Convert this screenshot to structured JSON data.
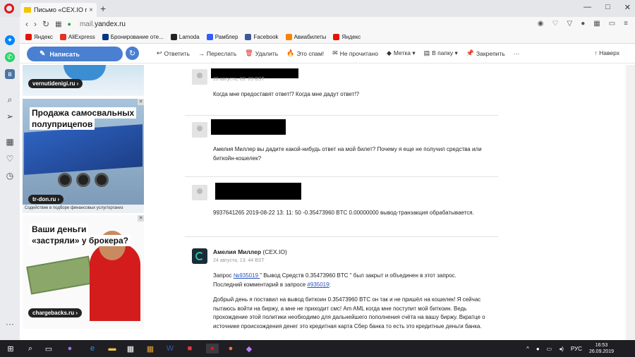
{
  "browser": {
    "tab_title": "Письмо «CEX.IO request»",
    "tab_close": "×",
    "new_tab": "+",
    "window_buttons": [
      "—",
      "□",
      "✕"
    ],
    "url_prefix": "mail.",
    "url_domain": "yandex.ru",
    "bookmarks": [
      {
        "label": "Яндекс",
        "color": "#e61400"
      },
      {
        "label": "AliExpress",
        "color": "#e43225"
      },
      {
        "label": "Бронирование оте...",
        "color": "#003580"
      },
      {
        "label": "Lamoda",
        "color": "#222222"
      },
      {
        "label": "Рамблер",
        "color": "#315efb"
      },
      {
        "label": "Facebook",
        "color": "#3b5998"
      },
      {
        "label": "Авиабилеты",
        "color": "#ff7f00"
      },
      {
        "label": "Яндекс",
        "color": "#e61400"
      }
    ],
    "sidebar_icons": [
      "messenger-icon",
      "whatsapp-icon",
      "vk-icon",
      "search-icon",
      "send-icon",
      "speed-dial-icon",
      "heart-icon",
      "history-icon",
      "more-icon"
    ]
  },
  "mail": {
    "compose_label": "Написать",
    "actions": [
      {
        "icon": "↩",
        "label": "Ответить"
      },
      {
        "icon": "→",
        "label": "Переслать"
      },
      {
        "icon": "🗑",
        "label": "Удалить"
      },
      {
        "icon": "🔥",
        "label": "Это спам!"
      },
      {
        "icon": "✉",
        "label": "Не прочитано"
      },
      {
        "icon": "◆",
        "label": "Метка ▾"
      },
      {
        "icon": "▤",
        "label": "В папку ▾"
      },
      {
        "icon": "📌",
        "label": "Закрепить"
      },
      {
        "icon": "",
        "label": "···"
      }
    ],
    "back_label": "Наверх",
    "messages": [
      {
        "date": "20 августа, 09: 20 BST",
        "body": "Когда мне предоставят ответ!? Когда мне дадут ответ!?"
      },
      {
        "body": "Амелия Миллер вы дадите какой-нибудь ответ на мой билет? Почему я еще не получил средства или биткойн-кошелек?"
      },
      {
        "body": "9937641265 2019-08-22 13: 11: 50 -0.35473960 BTC 0.00000000 вывод-транзакция обрабатывается."
      },
      {
        "sender_name": "Амелия Миллер",
        "sender_org": " (CEX.IO)",
        "date": "24 августа, 13: 44 BST",
        "p1_a": "Запрос ",
        "p1_link": "№935019 ",
        "p1_b": "\" Вывод Средств 0.35473960 BTC \" был закрыт и объединен в этот запрос.",
        "p1_c": "Последний комментарий в запросе ",
        "p1_link2": "#935019",
        "p1_d": ":",
        "p2": "Добрый день я поставил на вывод биткоин 0.35473960 BTC он так и не пришёл на кошелек! Я сейчас пытаюсь войти на биржу, а мне не приходит смс! Am AML когда мне поступит мой биткоин. Ведь прохождение этой политики необходимо для дальнейшего пополнения счёта на вашу биржу. Вкратце о источнике происхождения денег это кредитная карта Сбер банка то есть это кредитные деньги банка."
      }
    ]
  },
  "ads": {
    "ad1_tag": "vernutidenigi.ru ›",
    "ad2_headline_1": "Продажа самосвальных",
    "ad2_headline_2": "полуприцепов",
    "ad2_tag": "tr-don.ru ›",
    "ad2_footer": "Содействие в подборе финансовых услуг/организ",
    "ad3_headline_1": "Ваши деньги",
    "ad3_headline_2": "«застряли» у брокера?",
    "ad3_tag": "chargebacks.ru ›",
    "close": "✕"
  },
  "taskbar": {
    "lang": "РУС",
    "time": "16:53",
    "date": "26.09.2019"
  }
}
